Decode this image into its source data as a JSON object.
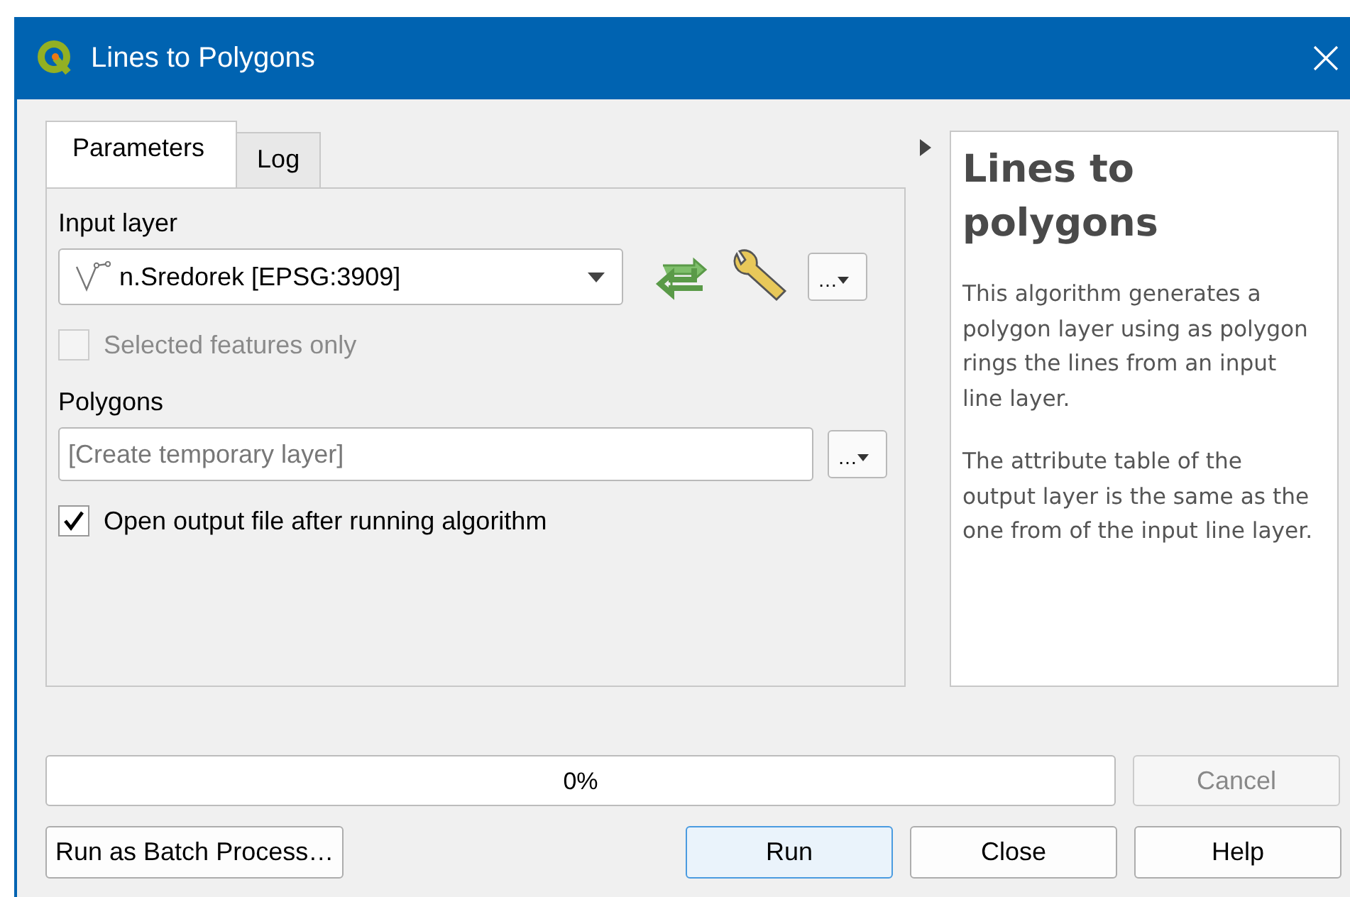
{
  "window": {
    "title": "Lines to Polygons"
  },
  "tabs": [
    {
      "label": "Parameters",
      "selected": true
    },
    {
      "label": "Log",
      "selected": false
    }
  ],
  "input_layer": {
    "label": "Input layer",
    "value": "n.Sredorek [EPSG:3909]",
    "browse_button": "…"
  },
  "selected_features_only": {
    "label": "Selected features only",
    "checked": false,
    "disabled": true
  },
  "polygons": {
    "label": "Polygons",
    "placeholder": "[Create temporary layer]",
    "browse_button": "…"
  },
  "open_output": {
    "label": "Open output file after running algorithm",
    "checked": true
  },
  "help": {
    "title": "Lines to polygons",
    "paragraphs": [
      "This algorithm generates a polygon layer using as polygon rings the lines from an input line layer.",
      "The attribute table of the output layer is the same as the one from of the input line layer."
    ]
  },
  "progress": {
    "level": 0,
    "reading": "0%"
  },
  "cancel_button": {
    "label": "Cancel",
    "disabled": true
  },
  "buttons": [
    {
      "label": "Run as Batch Process…",
      "focused": false
    },
    {
      "label": "Run",
      "focused": true
    },
    {
      "label": "Close",
      "focused": false
    },
    {
      "label": "Help",
      "focused": false
    }
  ]
}
